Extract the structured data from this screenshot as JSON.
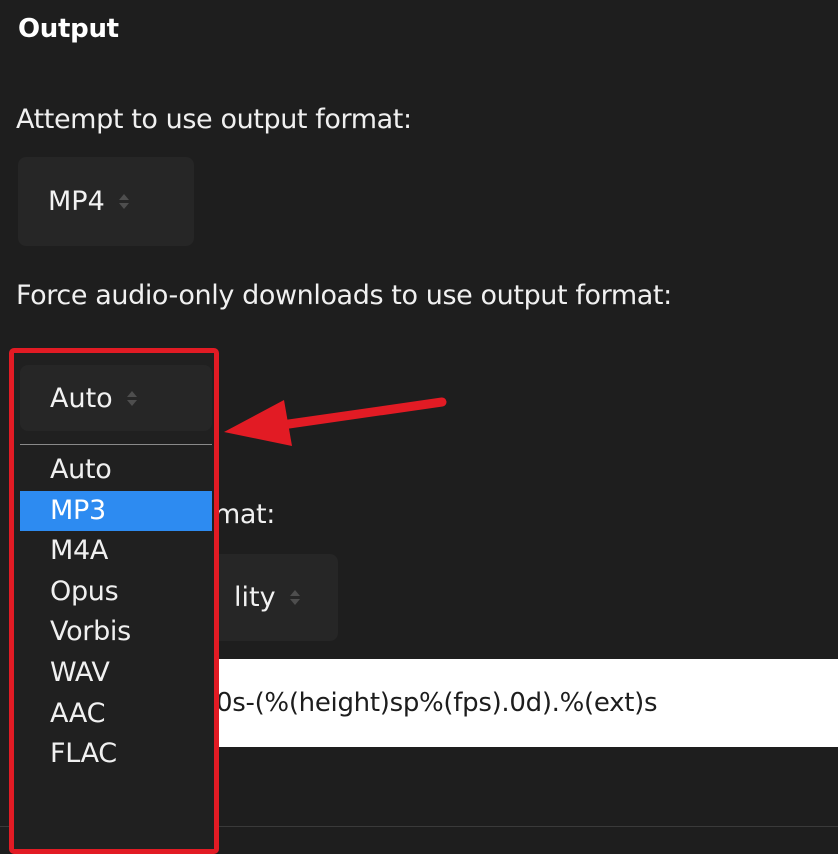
{
  "section": {
    "heading": "Output"
  },
  "output_format": {
    "label": "Attempt to use output format:",
    "selected": "MP4"
  },
  "audio_format": {
    "label": "Force audio-only downloads to use output format:",
    "selected": "Auto",
    "options": [
      "Auto",
      "MP3",
      "M4A",
      "Opus",
      "Vorbis",
      "WAV",
      "AAC",
      "FLAC"
    ],
    "highlighted": "MP3"
  },
  "obscured": {
    "label_fragment": "mat:",
    "select_fragment": "lity",
    "template_fragment": "0s-(%(height)sp%(fps).0d).%(ext)s"
  },
  "annotation": {
    "highlight_color": "#e21b24",
    "arrow_color": "#e21b24"
  },
  "colors": {
    "background": "#1e1e1e",
    "select_bg": "#262626",
    "accent": "#2d8bf1"
  }
}
